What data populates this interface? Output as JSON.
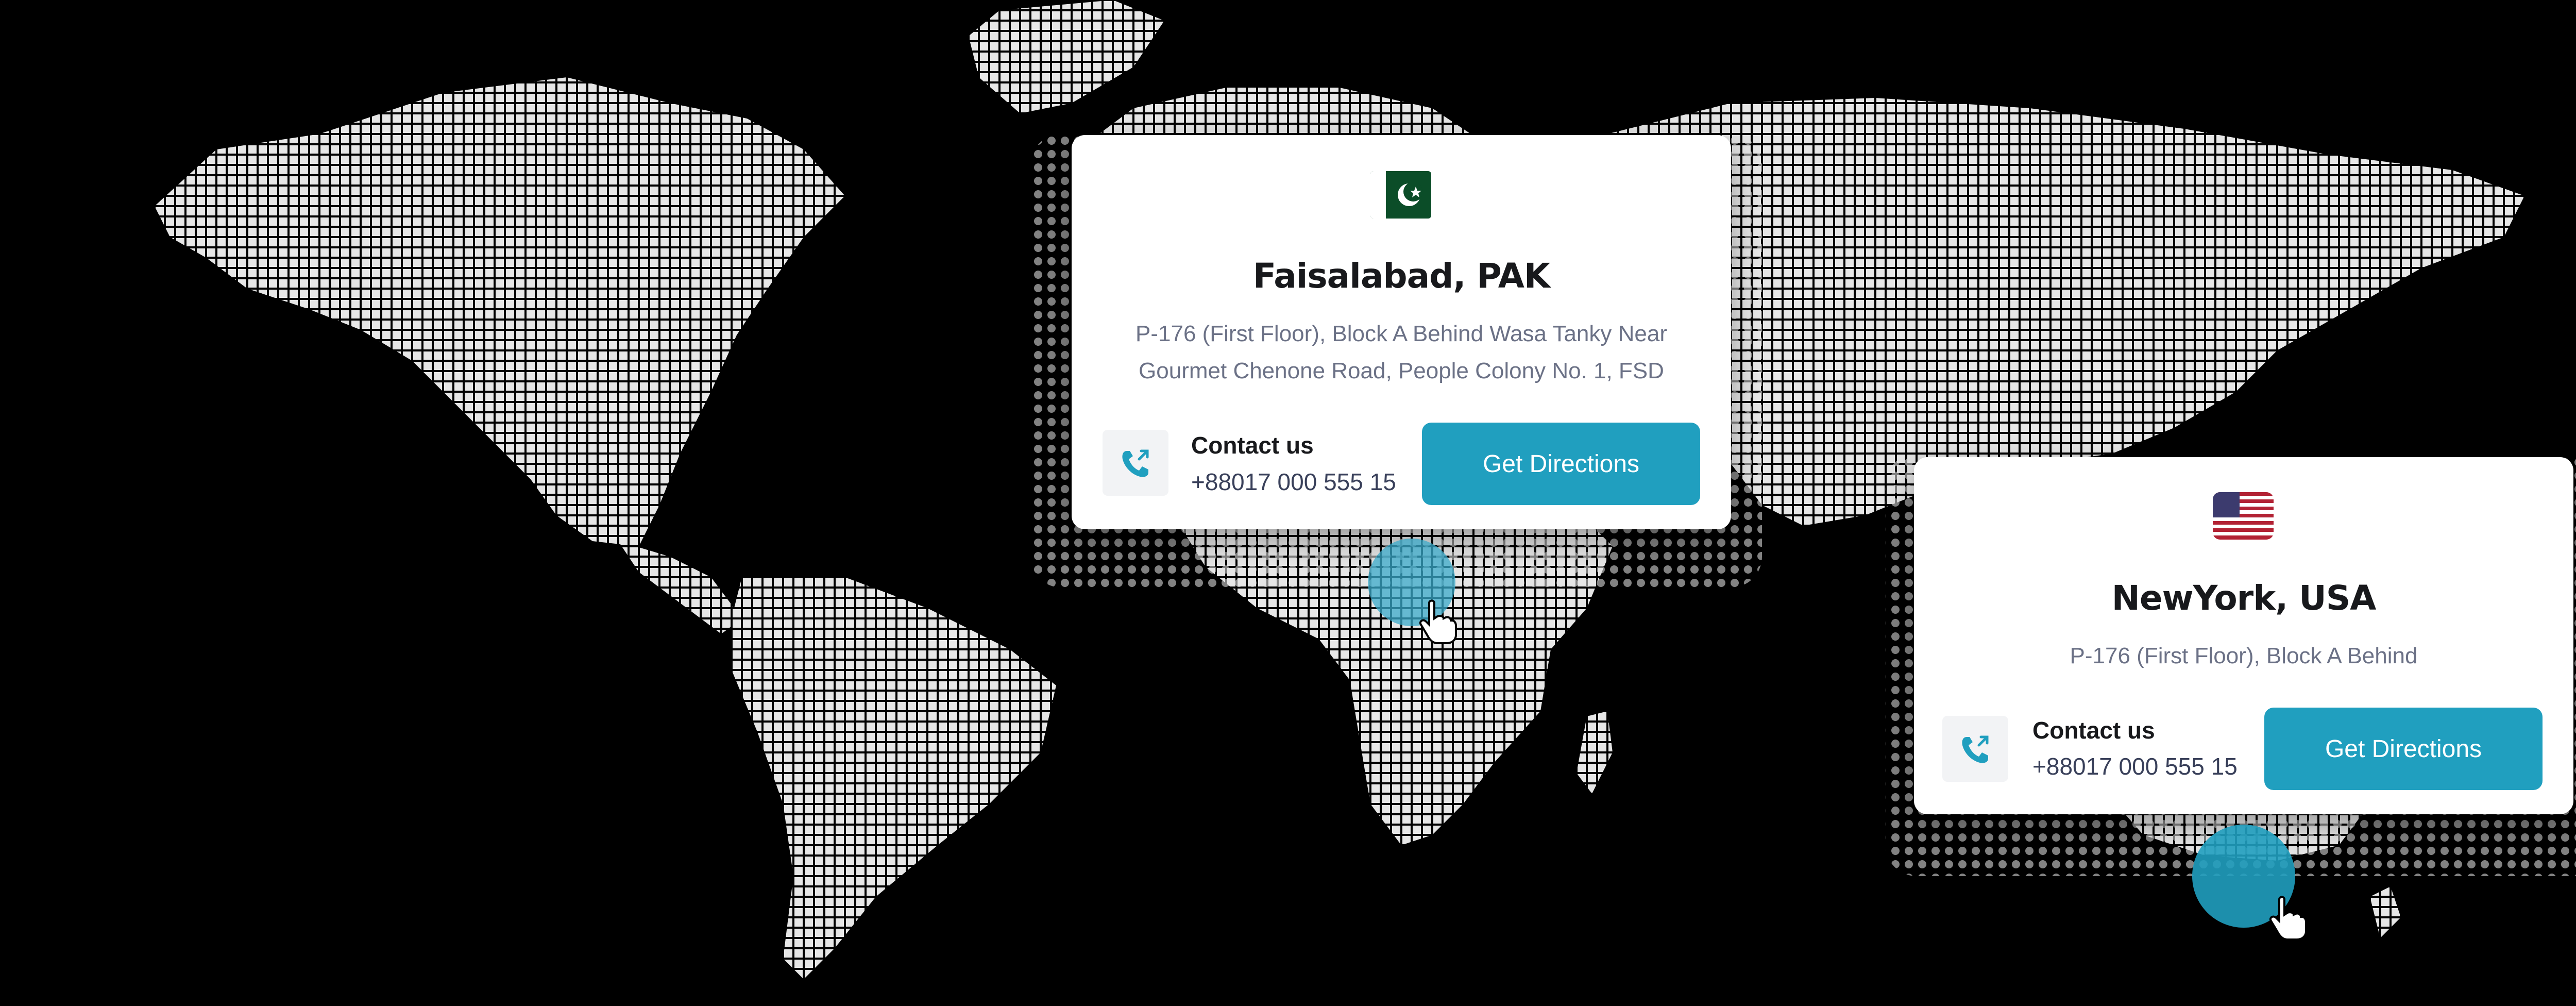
{
  "locations": [
    {
      "city": "Faisalabad, PAK",
      "country_flag": "pakistan-flag-icon",
      "address_lines": [
        "P-176 (First Floor), Block A Behind Wasa Tanky Near",
        "Gourmet Chenone Road, People Colony No. 1, FSD"
      ],
      "contact_label": "Contact us",
      "phone": "+88017 000 555 15",
      "button_label": "Get Directions"
    },
    {
      "city": "NewYork, USA",
      "country_flag": "usa-flag-icon",
      "address_lines": [
        "P-176 (First Floor), Block A Behind"
      ],
      "contact_label": "Contact us",
      "phone": "+88017 000 555 15",
      "button_label": "Get Directions"
    }
  ],
  "colors": {
    "background": "#000000",
    "land_dots": "#e6e6e6",
    "accent": "#209fbf",
    "pin": "#3aa9c9",
    "pakistan_green": "#0b4d28",
    "usa_red": "#b22234",
    "usa_blue": "#3c3b6e"
  },
  "icons": [
    "phone-call-icon",
    "hand-cursor-icon",
    "map-pin-icon"
  ]
}
